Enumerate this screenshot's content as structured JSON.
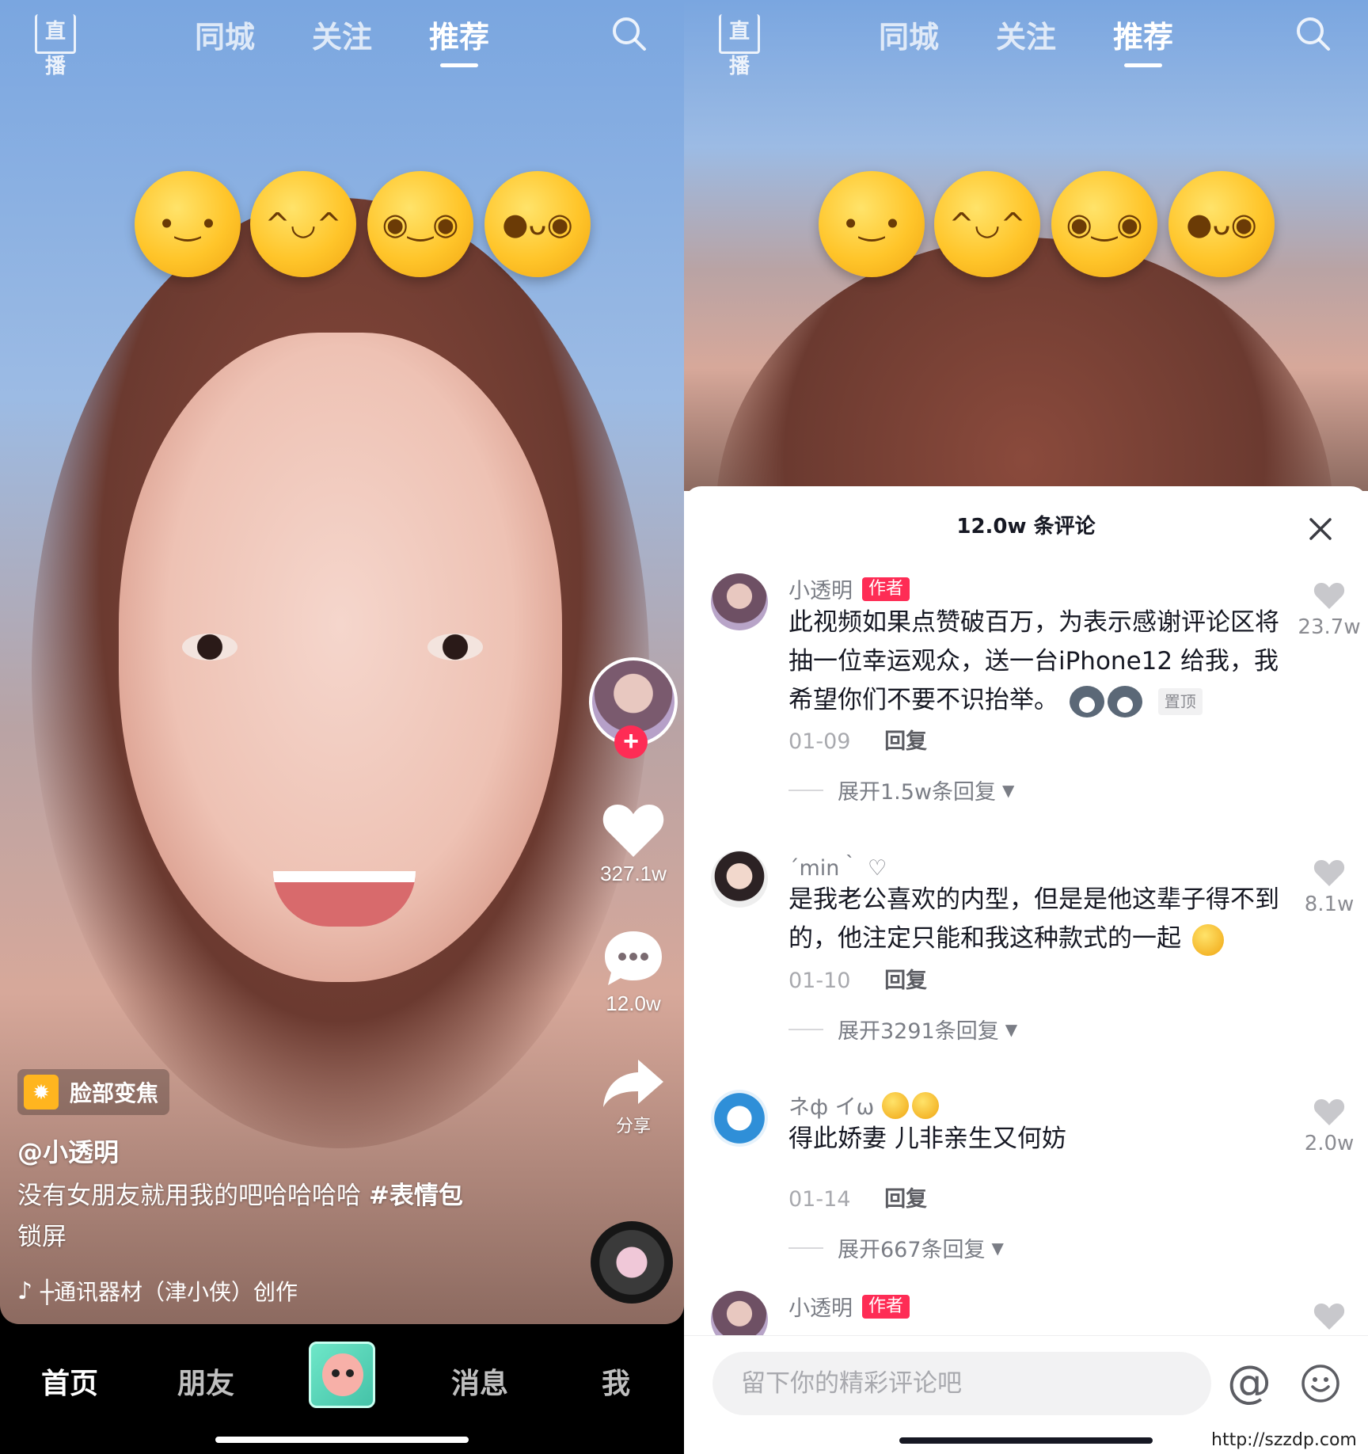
{
  "top_nav": {
    "live_label": "直播",
    "tabs": [
      "同城",
      "关注",
      "推荐"
    ],
    "active_tab": "推荐"
  },
  "video": {
    "actions": {
      "likes": "327.1w",
      "comments": "12.0w",
      "share_label": "分享"
    },
    "effect_label": "脸部变焦",
    "author": "@小透明",
    "caption_text": "没有女朋友就用我的吧哈哈哈哈",
    "caption_tag": "#表情包",
    "caption_tail": "锁屏",
    "music_text": "┼通讯器材（津小侠）创作",
    "emoji_overlay": [
      "smirk-emoji",
      "grin-emoji",
      "pleading-emoji",
      "zany-emoji"
    ]
  },
  "bottom_tabs": {
    "home": "首页",
    "friends": "朋友",
    "messages": "消息",
    "me": "我",
    "active": "首页"
  },
  "comments_sheet": {
    "title": "12.0w 条评论",
    "author_badge": "作者",
    "comments": [
      {
        "user": "小透明",
        "is_author": true,
        "text": "此视频如果点赞破百万，为表示感谢评论区将抽一位幸运观众，送一台iPhone12 给我，我希望你们不要不识抬举。",
        "pin_label": "置顶",
        "date": "01-09",
        "reply_label": "回复",
        "expand_label": "展开1.5w条回复",
        "likes": "23.7w"
      },
      {
        "user": "´min｀ ♡",
        "is_author": false,
        "text": "是我老公喜欢的内型，但是是他这辈子得不到的，他注定只能和我这种款式的一起",
        "date": "01-10",
        "reply_label": "回复",
        "expand_label": "展开3291条回复",
        "likes": "8.1w"
      },
      {
        "user": "ネф イω",
        "is_author": false,
        "text": "得此娇妻 儿非亲生又何妨",
        "date": "01-14",
        "reply_label": "回复",
        "expand_label": "展开667条回复",
        "likes": "2.0w"
      },
      {
        "user": "小透明",
        "is_author": true
      }
    ],
    "input_placeholder": "留下你的精彩评论吧",
    "at_symbol": "@"
  },
  "watermark": "http://szzdp.com",
  "colors": {
    "accent_red": "#fe2c55",
    "sky_blue": "#7aa6e0",
    "text_dark": "#161823",
    "text_gray": "#a8a9ae"
  }
}
